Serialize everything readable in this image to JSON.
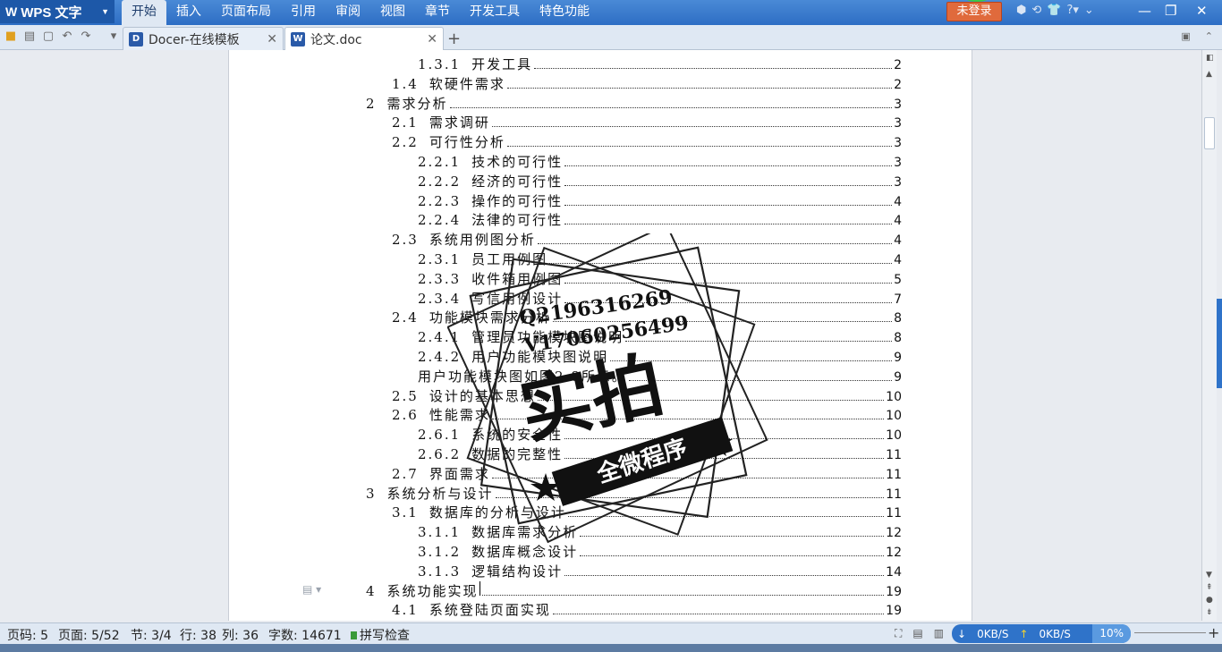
{
  "app": {
    "logo": "W",
    "name": "WPS 文字"
  },
  "menu": [
    "开始",
    "插入",
    "页面布局",
    "引用",
    "审阅",
    "视图",
    "章节",
    "开发工具",
    "特色功能"
  ],
  "active_menu": "开始",
  "login_label": "未登录",
  "tabs": [
    {
      "label": "Docer-在线模板",
      "icon": "D"
    },
    {
      "label": "论文.doc",
      "icon": "W"
    }
  ],
  "toc": [
    {
      "num": "1.3.1",
      "title": "开发工具",
      "page": "2",
      "level": 3
    },
    {
      "num": "1.4",
      "title": "软硬件需求",
      "page": "2",
      "level": 2
    },
    {
      "num": "2",
      "title": "需求分析",
      "page": "3",
      "level": 1
    },
    {
      "num": "2.1",
      "title": "需求调研",
      "page": "3",
      "level": 2
    },
    {
      "num": "2.2",
      "title": "可行性分析",
      "page": "3",
      "level": 2
    },
    {
      "num": "2.2.1",
      "title": "技术的可行性",
      "page": "3",
      "level": 3
    },
    {
      "num": "2.2.2",
      "title": "经济的可行性",
      "page": "3",
      "level": 3
    },
    {
      "num": "2.2.3",
      "title": "操作的可行性",
      "page": "4",
      "level": 3
    },
    {
      "num": "2.2.4",
      "title": "法律的可行性",
      "page": "4",
      "level": 3
    },
    {
      "num": "2.3",
      "title": "系统用例图分析",
      "page": "4",
      "level": 2
    },
    {
      "num": "2.3.1",
      "title": "员工用例图",
      "page": "4",
      "level": 3
    },
    {
      "num": "2.3.3",
      "title": "收件箱用例图",
      "page": "5",
      "level": 3
    },
    {
      "num": "2.3.4",
      "title": "写信用例设计",
      "page": "7",
      "level": 3
    },
    {
      "num": "2.4",
      "title": "功能模块需求分析",
      "page": "8",
      "level": 2
    },
    {
      "num": "2.4.1",
      "title": "管理员功能模块图说明",
      "page": "8",
      "level": 3
    },
    {
      "num": "2.4.2",
      "title": "用户功能模块图说明",
      "page": "9",
      "level": 3
    },
    {
      "num": "",
      "title": "用户功能模块图如图2.8所示。",
      "page": "9",
      "level": 3
    },
    {
      "num": "2.5",
      "title": "设计的基本思想",
      "page": "10",
      "level": 2
    },
    {
      "num": "2.6",
      "title": "性能需求",
      "page": "10",
      "level": 2
    },
    {
      "num": "2.6.1",
      "title": "系统的安全性",
      "page": "10",
      "level": 3
    },
    {
      "num": "2.6.2",
      "title": "数据的完整性",
      "page": "11",
      "level": 3
    },
    {
      "num": "2.7",
      "title": "界面需求",
      "page": "11",
      "level": 2
    },
    {
      "num": "3",
      "title": "系统分析与设计",
      "page": "11",
      "level": 1
    },
    {
      "num": "3.1",
      "title": "数据库的分析与设计",
      "page": "11",
      "level": 2
    },
    {
      "num": "3.1.1",
      "title": "数据库需求分析",
      "page": "12",
      "level": 3
    },
    {
      "num": "3.1.2",
      "title": "数据库概念设计",
      "page": "12",
      "level": 3
    },
    {
      "num": "3.1.3",
      "title": "逻辑结构设计",
      "page": "14",
      "level": 3
    },
    {
      "num": "4",
      "title": "系统功能实现",
      "page": "19",
      "level": 1
    },
    {
      "num": "4.1",
      "title": "系统登陆页面实现",
      "page": "19",
      "level": 2
    }
  ],
  "stamp": {
    "qq": "Q2196316269",
    "wx": "V17060256499",
    "big": "实拍",
    "banner": "全微程序"
  },
  "status": {
    "page_code": "页码: 5",
    "page": "页面: 5/52",
    "section": "节: 3/4",
    "row": "行: 38",
    "col": "列: 36",
    "words": "字数: 14671",
    "spell": "拼写检查",
    "down": "0KB/S",
    "up": "0KB/S",
    "zoom": "10%"
  }
}
